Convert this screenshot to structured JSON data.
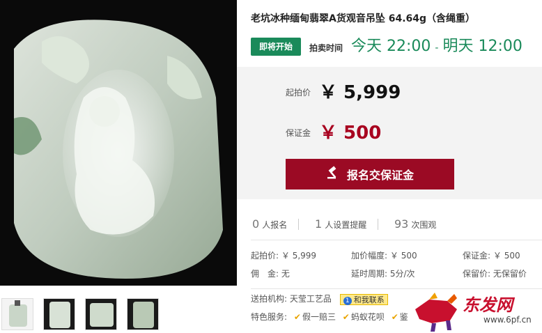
{
  "product": {
    "title": "老坑冰种缅甸翡翠A货观音吊坠 64.64g（含绳重）",
    "image_alt": "jade guanyin pendant",
    "thumbnails": [
      "thumb-1",
      "thumb-2",
      "thumb-3",
      "thumb-4"
    ]
  },
  "auction": {
    "status_badge": "即将开始",
    "time_label": "拍卖时间",
    "start_time": "今天 22:00",
    "separator": "-",
    "end_time": "明天 12:00"
  },
  "prices": {
    "start_label": "起拍价",
    "start_value": "￥ 5,999",
    "deposit_label": "保证金",
    "deposit_value": "￥ 500",
    "signup_button": "报名交保证金"
  },
  "stats": {
    "signups_num": "0",
    "signups_label": "人报名",
    "reminders_num": "1",
    "reminders_label": "人设置提醒",
    "views_num": "93",
    "views_label": "次围观"
  },
  "info": {
    "start_price": "起拍价:",
    "start_price_val": "￥ 5,999",
    "increment": "加价幅度:",
    "increment_val": "￥ 500",
    "deposit": "保证金:",
    "deposit_val": "￥ 500",
    "commission": "佣　金:",
    "commission_val": "无",
    "extension": "延时周期:",
    "extension_val": "5分/次",
    "reserve": "保留价:",
    "reserve_val": "无保留价"
  },
  "org": {
    "label": "送拍机构:",
    "name": "天莹工艺品",
    "contact_icon": "1",
    "contact": "和我联系"
  },
  "services": {
    "label": "特色服务:",
    "items": [
      "假一赔三",
      "蚂蚁花呗",
      "鉴"
    ]
  },
  "watermark": {
    "text": "东发网",
    "url": "www.6pf.cn"
  },
  "colors": {
    "green": "#1a8a5a",
    "red": "#9b0a24",
    "price_red": "#a8001f"
  }
}
